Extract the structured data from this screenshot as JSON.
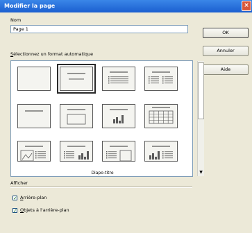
{
  "window": {
    "title": "Modifier la page",
    "close_glyph": "×"
  },
  "name_section": {
    "label": "Nom",
    "value": "Page 1"
  },
  "autoformat": {
    "label_u": "S",
    "label_rest": "électionnez un format automatique"
  },
  "buttons": {
    "ok": "OK",
    "cancel": "Annuler",
    "help": "Aide"
  },
  "gallery": {
    "caption": "Diapo-titre",
    "tiles": [
      "blank",
      "title-line",
      "title-bullets",
      "title-two-bullets",
      "title-only",
      "title-content",
      "title-chart",
      "title-table",
      "image-text",
      "text-chart",
      "text-clipart",
      "chart-text"
    ],
    "selected_index": 1
  },
  "display": {
    "label": "Afficher",
    "options": [
      {
        "u": "A",
        "rest": "rrière-plan",
        "checked": true
      },
      {
        "u": "O",
        "rest": "bjets à l'arrière-plan",
        "checked": true
      }
    ],
    "check_glyph": "✓"
  }
}
